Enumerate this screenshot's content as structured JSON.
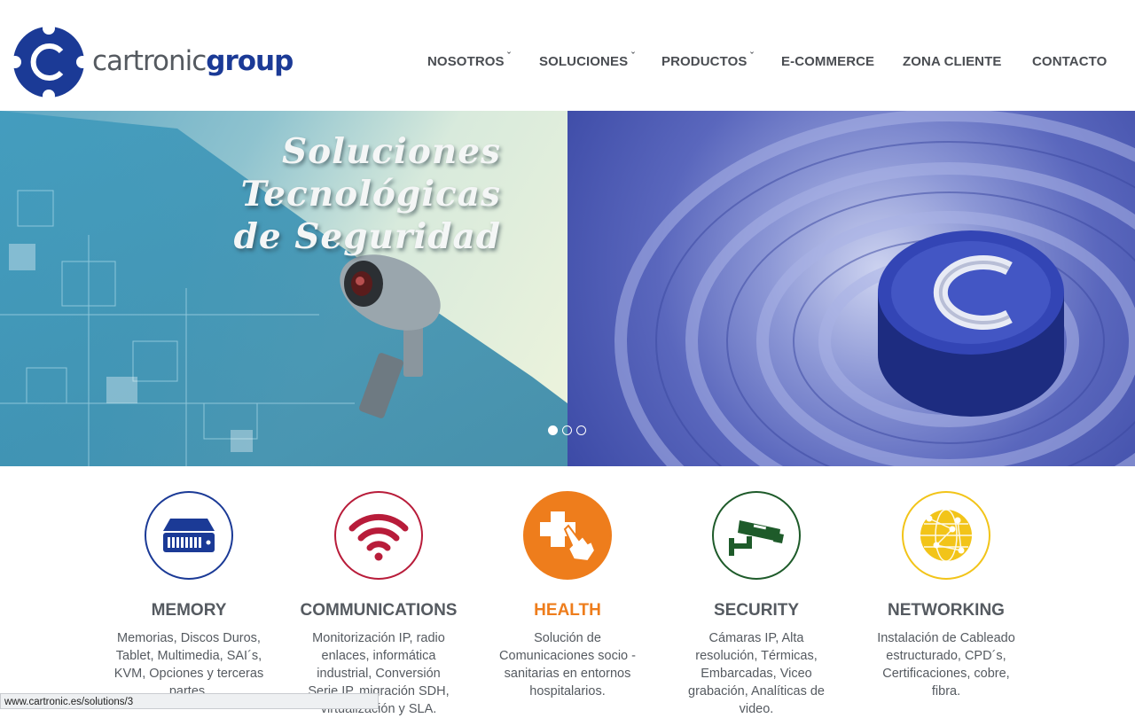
{
  "logo": {
    "part1": "cartronic",
    "part2": "group"
  },
  "nav": [
    {
      "label": "NOSOTROS",
      "dropdown": true
    },
    {
      "label": "SOLUCIONES",
      "dropdown": true
    },
    {
      "label": "PRODUCTOS",
      "dropdown": true
    },
    {
      "label": "E-COMMERCE",
      "dropdown": false
    },
    {
      "label": "ZONA CLIENTE",
      "dropdown": false
    },
    {
      "label": "CONTACTO",
      "dropdown": false
    }
  ],
  "hero": {
    "title_line1": "Soluciones Tecnológicas",
    "title_line2": "de Seguridad",
    "slides": 3,
    "active_slide": 1
  },
  "solutions": [
    {
      "title": "MEMORY",
      "desc": "Memorias, Discos Duros, Tablet, Multimedia, SAI´s, KVM, Opciones y terceras partes.",
      "color": "#1b3a96",
      "icon": "server-icon",
      "highlight": false
    },
    {
      "title": "COMMUNICATIONS",
      "desc": "Monitorización IP, radio enlaces, informática industrial, Conversión Serie IP, migración SDH, virtualización y SLA.",
      "color": "#b81c3a",
      "icon": "wifi-icon",
      "highlight": false
    },
    {
      "title": "HEALTH",
      "desc": "Solución de Comunicaciones socio - sanitarias en entornos hospitalarios.",
      "color": "#ee7d1c",
      "icon": "medical-touch-icon",
      "highlight": true
    },
    {
      "title": "SECURITY",
      "desc": "Cámaras IP, Alta resolución, Térmicas, Embarcadas, Viceo grabación, Analíticas de video.",
      "color": "#1e5b2a",
      "icon": "cctv-camera-icon",
      "highlight": false
    },
    {
      "title": "NETWORKING",
      "desc": "Instalación de Cableado estructurado, CPD´s, Certificaciones, cobre, fibra.",
      "color": "#f2c419",
      "icon": "network-globe-icon",
      "highlight": false
    }
  ],
  "statusbar": {
    "url": "www.cartronic.es/solutions/3"
  },
  "colors": {
    "brand_blue": "#1b3a96",
    "text_gray": "#555a60",
    "health_orange": "#ee7d1c"
  }
}
